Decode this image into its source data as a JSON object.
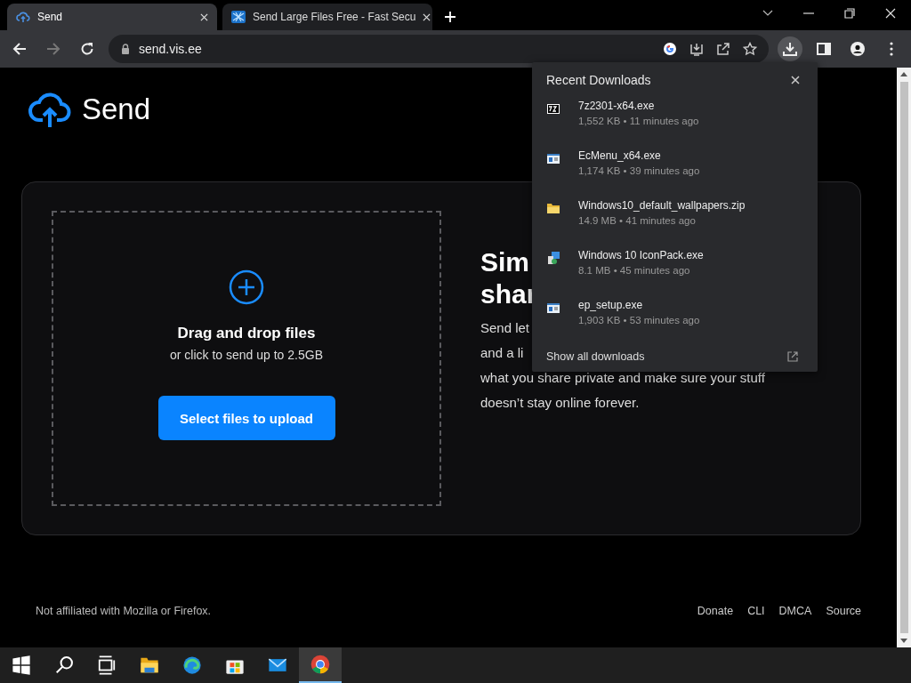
{
  "tabs": [
    {
      "title": "Send",
      "selected": true,
      "kind": "cloud"
    },
    {
      "title": "Send Large Files Free - Fast Secu",
      "selected": false,
      "kind": "hatch"
    }
  ],
  "address": "send.vis.ee",
  "site": {
    "logo": "Send",
    "dropzone": {
      "title": "Drag and drop files",
      "subtitle": "or click to send up to 2.5GB",
      "button": "Select files to upload"
    },
    "heading_lines": [
      "Sim",
      "shar"
    ],
    "paragraph_lines": [
      "Send let",
      "and a li",
      "what you share private and make sure your stuff",
      "doesn’t stay online forever."
    ],
    "footer_note": "Not affiliated with Mozilla or Firefox.",
    "footer_links": [
      "Donate",
      "CLI",
      "DMCA",
      "Source"
    ]
  },
  "downloads": {
    "title": "Recent Downloads",
    "show_all": "Show all downloads",
    "items": [
      {
        "name": "7z2301-x64.exe",
        "meta": "1,552 KB • 11 minutes ago",
        "kind": "archive-app"
      },
      {
        "name": "EcMenu_x64.exe",
        "meta": "1,174 KB • 39 minutes ago",
        "kind": "window-app"
      },
      {
        "name": "Windows10_default_wallpapers.zip",
        "meta": "14.9 MB • 41 minutes ago",
        "kind": "folder"
      },
      {
        "name": "Windows 10 IconPack.exe",
        "meta": "8.1 MB • 45 minutes ago",
        "kind": "installer"
      },
      {
        "name": "ep_setup.exe",
        "meta": "1,903 KB • 53 minutes ago",
        "kind": "window-app"
      }
    ]
  },
  "taskbar": [
    {
      "kind": "start",
      "selected": false
    },
    {
      "kind": "search",
      "selected": false
    },
    {
      "kind": "taskview",
      "selected": false
    },
    {
      "kind": "explorer",
      "selected": false
    },
    {
      "kind": "edge",
      "selected": false
    },
    {
      "kind": "store",
      "selected": false
    },
    {
      "kind": "mail",
      "selected": false
    },
    {
      "kind": "chrome",
      "selected": true
    }
  ]
}
